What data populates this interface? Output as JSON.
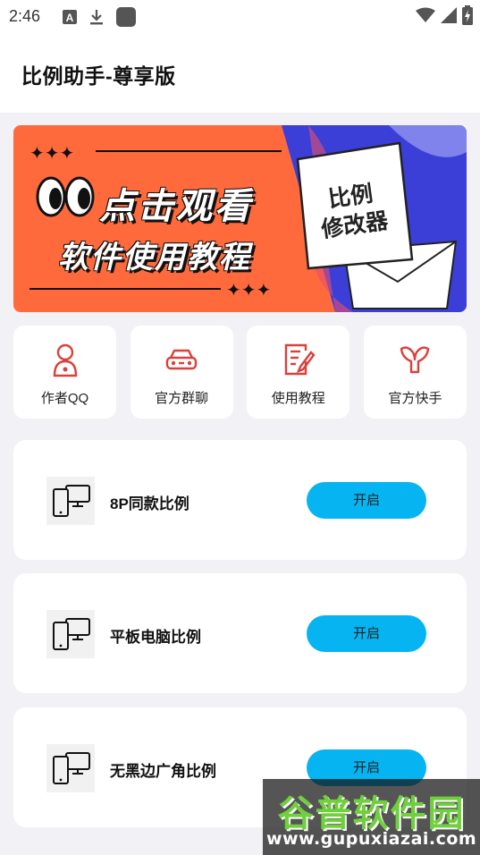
{
  "status_bar": {
    "time": "2:46",
    "left_icons": [
      "font-icon",
      "download-icon",
      "app-square-icon"
    ],
    "right_icons": [
      "wifi-icon",
      "signal-icon",
      "battery-charging-icon"
    ]
  },
  "app_bar": {
    "title": "比例助手-尊享版"
  },
  "banner": {
    "headline": "点击观看",
    "subline": "软件使用教程",
    "note_line1": "比例",
    "note_line2": "修改器",
    "left_color": "#ff6a3d",
    "right_color": "#3b3fd8"
  },
  "quick_actions": [
    {
      "label": "作者QQ",
      "icon": "person-icon"
    },
    {
      "label": "官方群聊",
      "icon": "car-icon"
    },
    {
      "label": "使用教程",
      "icon": "document-edit-icon"
    },
    {
      "label": "官方快手",
      "icon": "kuaishou-icon"
    }
  ],
  "options": [
    {
      "label": "8P同款比例",
      "button": "开启",
      "icon": "phone-monitor-icon"
    },
    {
      "label": "平板电脑比例",
      "button": "开启",
      "icon": "phone-monitor-icon"
    },
    {
      "label": "无黑边广角比例",
      "button": "开启",
      "icon": "phone-monitor-icon"
    }
  ],
  "watermark": {
    "title": "谷普软件园",
    "url": "www.gupuxiazai.com"
  },
  "colors": {
    "accent_red": "#d9413a",
    "button_blue": "#06b4f2",
    "background": "#f2f2f6"
  }
}
